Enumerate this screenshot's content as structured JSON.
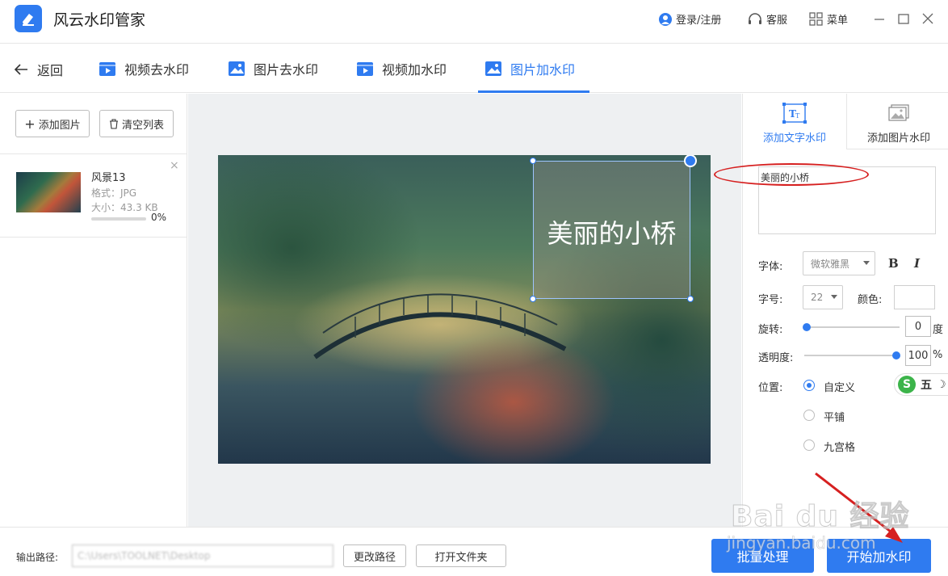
{
  "app": {
    "title": "风云水印管家"
  },
  "titlebar": {
    "login_label": "登录/注册",
    "service_label": "客服",
    "menu_label": "菜单"
  },
  "nav": {
    "back_label": "返回",
    "tabs": [
      {
        "label": "视频去水印",
        "icon": "video-icon"
      },
      {
        "label": "图片去水印",
        "icon": "image-icon"
      },
      {
        "label": "视频加水印",
        "icon": "video-icon"
      },
      {
        "label": "图片加水印",
        "icon": "image-icon",
        "active": true
      }
    ]
  },
  "left": {
    "add_image_label": "添加图片",
    "clear_list_label": "清空列表",
    "file": {
      "name": "风景13",
      "format": "格式：JPG",
      "size": "大小：43.3 KB",
      "progress_text": "0%",
      "progress": 0
    }
  },
  "preview": {
    "watermark_text": "美丽的小桥"
  },
  "right": {
    "tab_text_label": "添加文字水印",
    "tab_image_label": "添加图片水印",
    "watermark_input": "美丽的小桥",
    "font_label": "字体:",
    "font_value": "微软雅黑",
    "bold_label": "B",
    "italic_label": "I",
    "size_label": "字号:",
    "size_value": "22",
    "color_label": "颜色:",
    "rotate_label": "旋转:",
    "rotate_value": "0",
    "rotate_unit": "度",
    "opacity_label": "透明度:",
    "opacity_value": "100",
    "opacity_unit": "%",
    "position_label": "位置:",
    "position_options": [
      "自定义",
      "平铺",
      "九宫格"
    ],
    "ime_label": "五"
  },
  "bottom": {
    "output_label": "输出路径:",
    "output_path": "C:\\Users\\TOOLNET\\Desktop",
    "change_path_label": "更改路径",
    "open_folder_label": "打开文件夹",
    "batch_label": "批量处理",
    "start_label": "开始加水印"
  },
  "overlay": {
    "watermark_line1": "Bai du 经验",
    "watermark_line2": "jingyan.baidu.com"
  }
}
